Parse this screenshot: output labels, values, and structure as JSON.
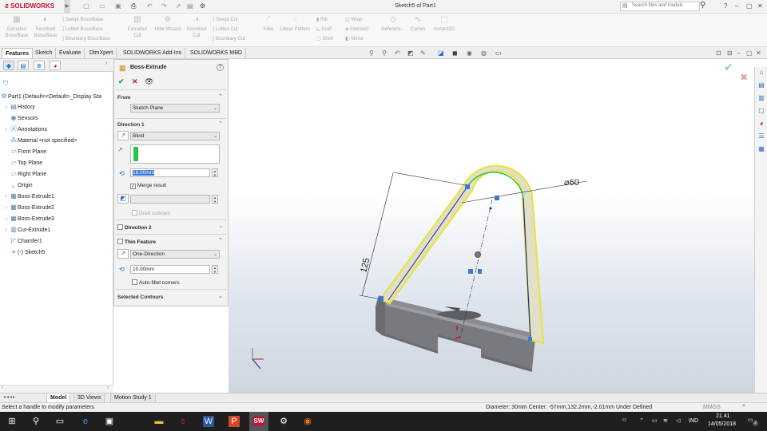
{
  "app": {
    "logo_text": "SOLIDWORKS",
    "doc_title": "Sketch5 of Part1"
  },
  "search": {
    "placeholder": "Search files and models"
  },
  "commands": {
    "extruded_boss": "Extruded Boss/Base",
    "revolved_boss": "Revolved Boss/Base",
    "swept_boss": "Swept Boss/Base",
    "lofted_boss": "Lofted Boss/Base",
    "boundary_boss": "Boundary Boss/Base",
    "extruded_cut": "Extruded Cut",
    "hole_wizard": "Hole Wizard",
    "revolved_cut": "Revolved Cut",
    "swept_cut": "Swept Cut",
    "lofted_cut": "Lofted Cut",
    "boundary_cut": "Boundary Cut",
    "fillet": "Fillet",
    "linear_pattern": "Linear Pattern",
    "rib": "Rib",
    "draft": "Draft",
    "shell": "Shell",
    "wrap": "Wrap",
    "intersect": "Intersect",
    "mirror": "Mirror",
    "reference": "Referenc...",
    "curves": "Curves",
    "instant3d": "Instant3D"
  },
  "tabs": [
    "Features",
    "Sketch",
    "Evaluate",
    "DimXpert",
    "SOLIDWORKS Add-Ins",
    "SOLIDWORKS MBD"
  ],
  "tree": {
    "root": "Part1  (Default<<Default>_Display Sta",
    "items": [
      "History",
      "Sensors",
      "Annotations",
      "Material <not specified>",
      "Front Plane",
      "Top Plane",
      "Right Plane",
      "Origin",
      "Boss-Extrude1",
      "Boss-Extrude2",
      "Boss-Extrude3",
      "Cut-Extrude1",
      "Chamfer1",
      "(-) Sketch5"
    ]
  },
  "pm": {
    "title": "Boss-Extrude",
    "from_label": "From",
    "from_value": "Sketch Plane",
    "dir1_label": "Direction 1",
    "dir1_type": "Blind",
    "depth": "18.00mm",
    "merge_result": "Merge result",
    "draft_outward": "Draft outward",
    "dir2_label": "Direction 2",
    "thin_label": "Thin Feature",
    "thin_type": "One-Direction",
    "thin_depth": "10.00mm",
    "auto_fillet": "Auto-fillet corners",
    "selected_contours": "Selected Contours"
  },
  "viewport": {
    "dim_diameter": "⌀60",
    "dim_length": "125"
  },
  "bottom_tabs": [
    "Model",
    "3D Views",
    "Motion Study 1"
  ],
  "status": {
    "hint": "Select a handle to modify parameters",
    "info": "Diameter: 30mm  Center: -57mm,132.2mm,-2.01mm   Under Defined",
    "units": "MMGS"
  },
  "clock": {
    "time": "21.41",
    "date": "14/05/2018",
    "lang": "IND",
    "notif": "2"
  },
  "colors": {
    "accent": "#c8102e",
    "sketch_yellow": "#e9e23a",
    "body": "#7d7f86",
    "selection_green": "#27c44c"
  }
}
